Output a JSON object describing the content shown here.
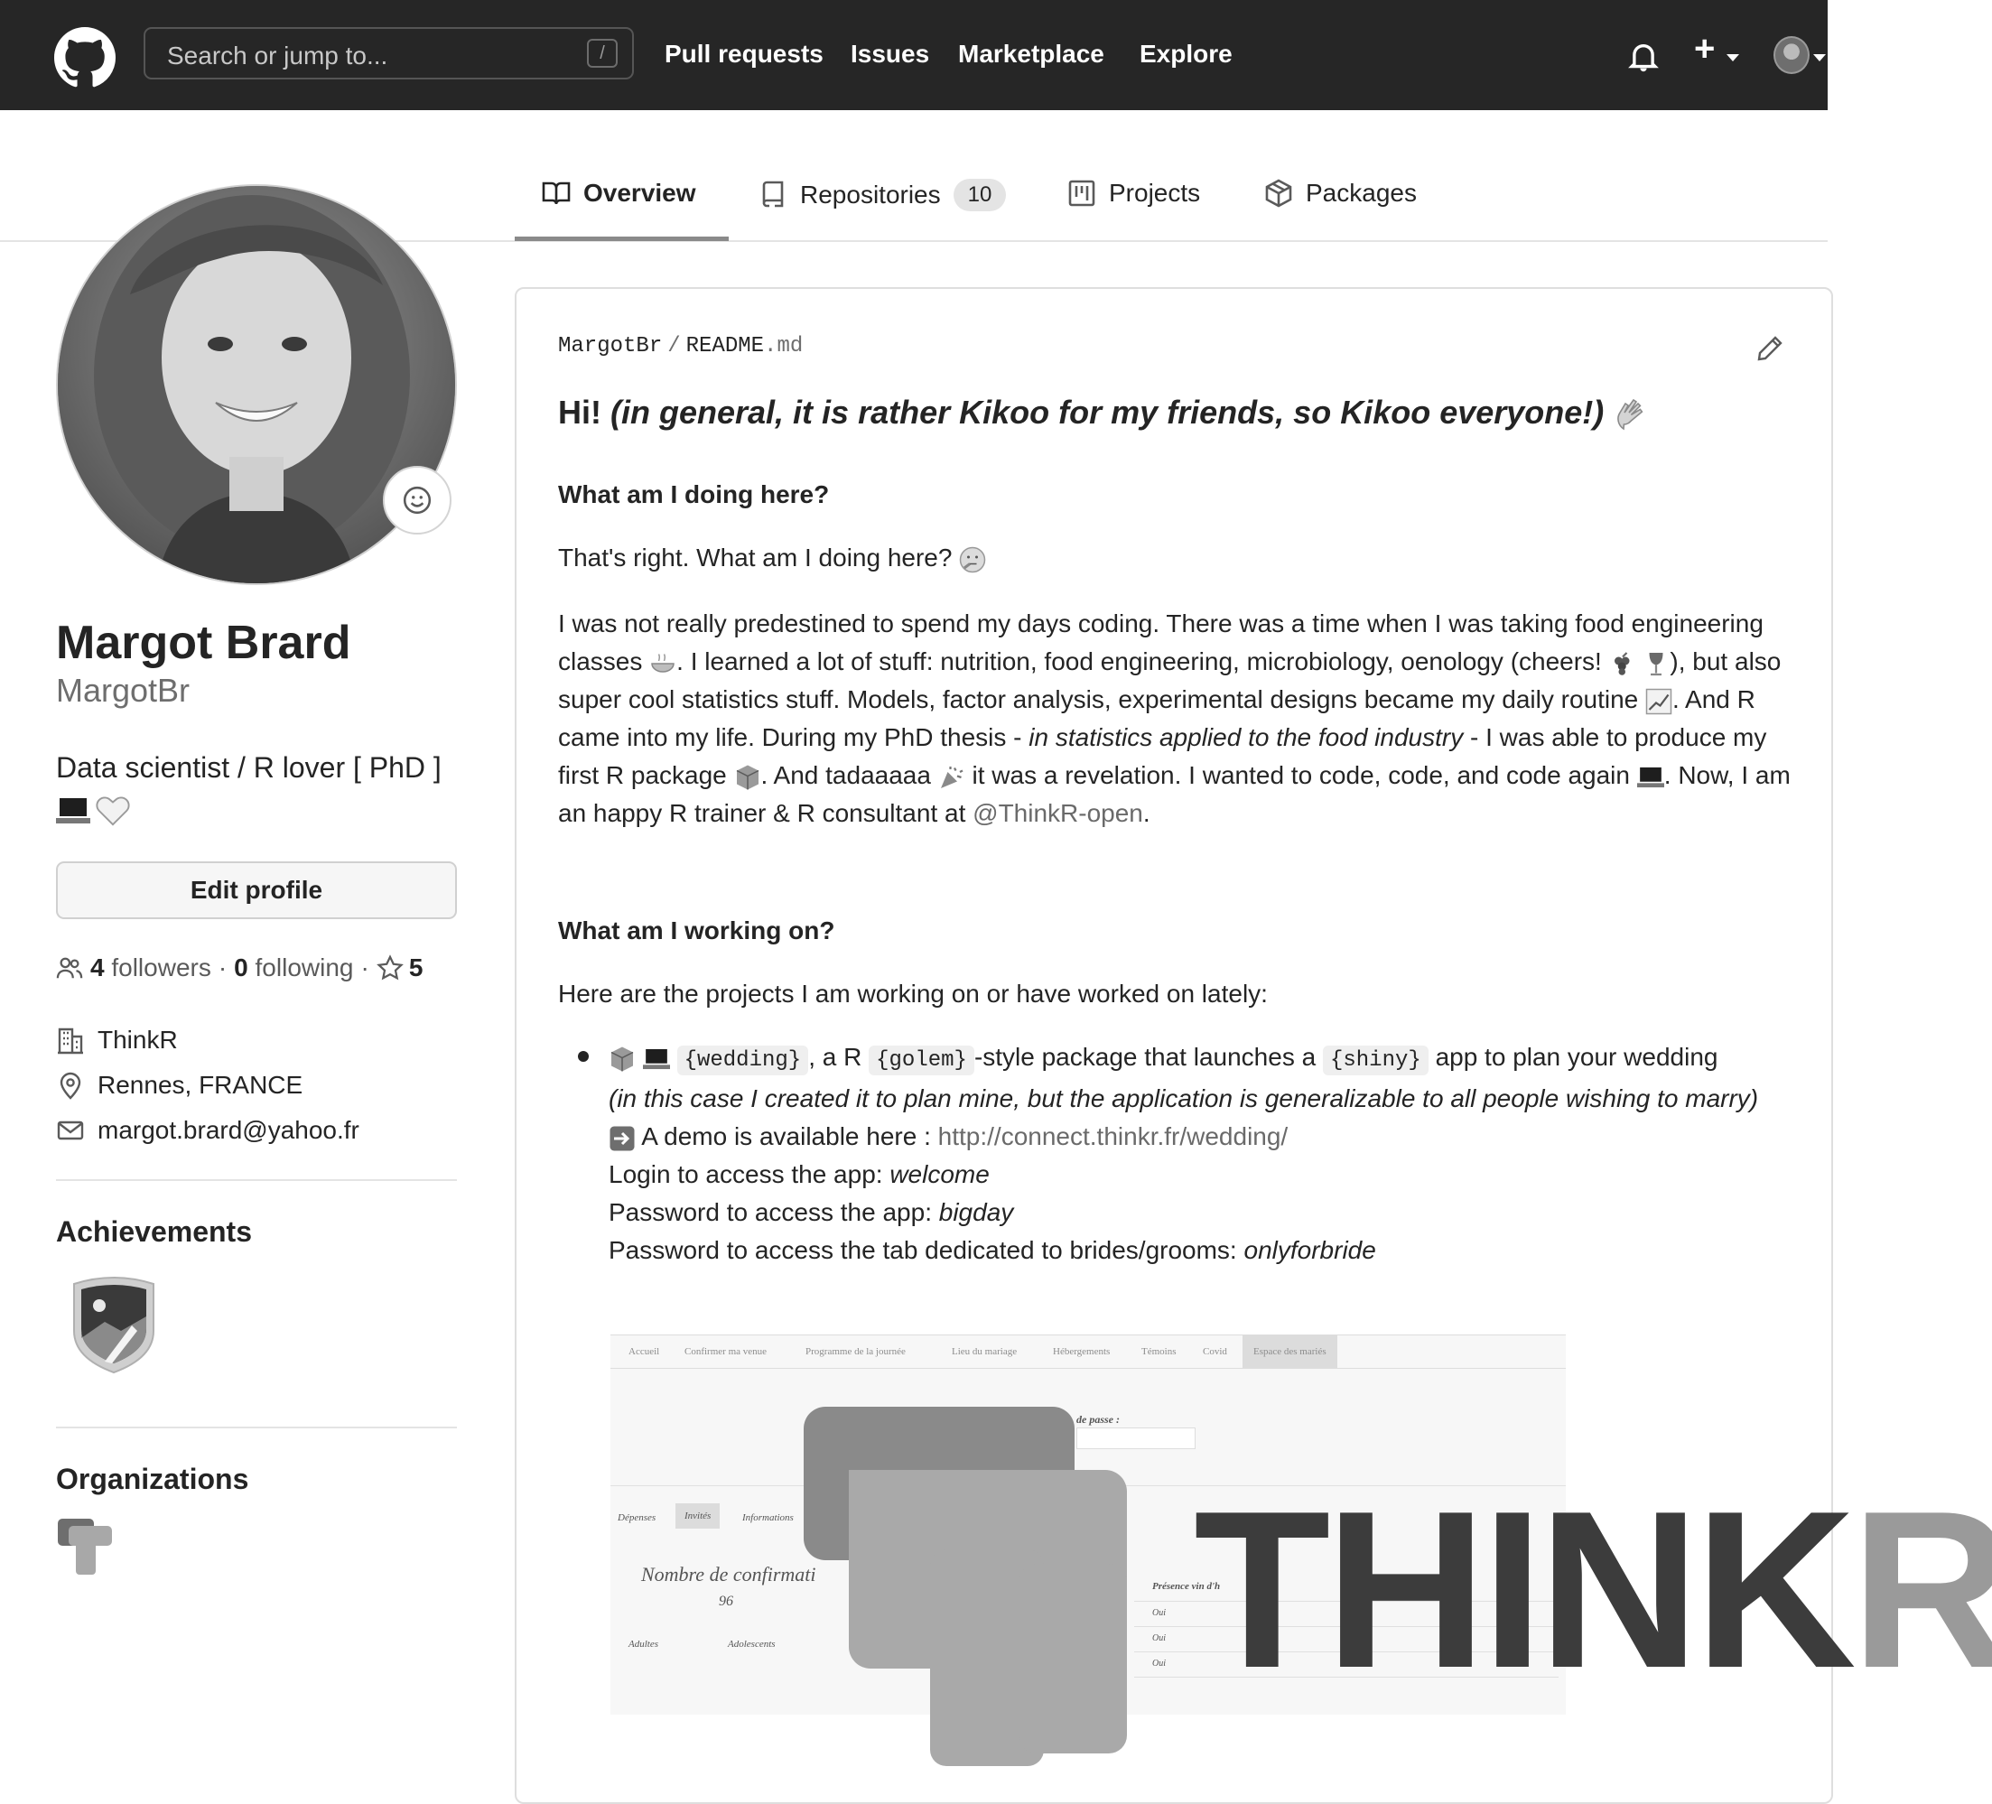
{
  "header": {
    "search_placeholder": "Search or jump to...",
    "search_shortcut": "/",
    "nav": [
      "Pull requests",
      "Issues",
      "Marketplace",
      "Explore"
    ]
  },
  "tabs": [
    {
      "label": "Overview",
      "active": true
    },
    {
      "label": "Repositories",
      "count": "10"
    },
    {
      "label": "Projects"
    },
    {
      "label": "Packages"
    }
  ],
  "profile": {
    "name": "Margot Brard",
    "username": "MargotBr",
    "bio": "Data scientist / R lover [ PhD ]",
    "bio_emojis": [
      "laptop-emoji",
      "white-heart-emoji"
    ],
    "edit_label": "Edit profile",
    "followers_count": "4",
    "followers_label": "followers",
    "following_count": "0",
    "following_label": "following",
    "stars_count": "5",
    "company": "ThinkR",
    "location": "Rennes, FRANCE",
    "email": "margot.brard@yahoo.fr",
    "achievements_heading": "Achievements",
    "organizations_heading": "Organizations"
  },
  "readme": {
    "owner": "MargotBr",
    "file": "README",
    "ext": ".md",
    "title_plain": "Hi!",
    "title_italic": "(in general, it is rather Kikoo for my friends, so Kikoo everyone!)",
    "h_doing": "What am I doing here?",
    "p_doing": "That's right. What am I doing here?",
    "p_story_1": "I was not really predestined to spend my days coding. There was a time when I was taking food engineering classes",
    "p_story_2": ". I learned a lot of stuff: nutrition, food engineering, microbiology, oenology (cheers!",
    "p_story_3": "), but also super cool statistics stuff. Models, factor analysis, experimental designs became my daily routine",
    "p_story_4": ". And R came into my life. During my PhD thesis -",
    "p_story_italic": "in statistics applied to the food industry",
    "p_story_5": "- I was able to produce my first R package",
    "p_story_6": ". And tadaaaaa",
    "p_story_7": "it was a revelation. I wanted to code, code, and code again",
    "p_story_8": ". Now, I am an happy R trainer & R consultant at",
    "p_story_link": "@ThinkR-open",
    "p_story_end": ".",
    "h_working": "What am I working on?",
    "p_working": "Here are the projects I am working on or have worked on lately:",
    "item_code_1": "{wedding}",
    "item_text_1": ", a R",
    "item_code_2": "{golem}",
    "item_text_2": "-style package that launches a",
    "item_code_3": "{shiny}",
    "item_text_3": "app to plan your wedding",
    "item_italic": "(in this case I created it to plan mine, but the application is generalizable to all people wishing to marry)",
    "demo_text": "A demo is available here :",
    "demo_link": "http://connect.thinkr.fr/wedding/",
    "login_text": "Login to access the app:",
    "login_value": "welcome",
    "pwd_text": "Password to access the app:",
    "pwd_value": "bigday",
    "pwd_tab_text": "Password to access the tab dedicated to brides/grooms:",
    "pwd_tab_value": "onlyforbride"
  },
  "screenshot": {
    "tabs": [
      "Accueil",
      "Confirmer ma venue",
      "Programme de la journée",
      "Lieu du mariage",
      "Hébergements",
      "Témoins",
      "Covid",
      "Espace des mariés"
    ],
    "sub_tabs": [
      "Dépenses",
      "Invités",
      "Informations"
    ],
    "pass_label": "de passe :",
    "confirm_title": "Nombre de confirmati",
    "confirm_count": "96",
    "adults_label": "Adultes",
    "teens_label": "Adolescents",
    "col_presence": "Présence vin d'h",
    "cell_value": "Oui"
  },
  "watermark": {
    "word_main": "THINK",
    "word_accent": "R"
  },
  "colors": {
    "topbar": "#262626",
    "text": "#242424",
    "muted": "#6e6e6e",
    "border": "#dedede"
  }
}
